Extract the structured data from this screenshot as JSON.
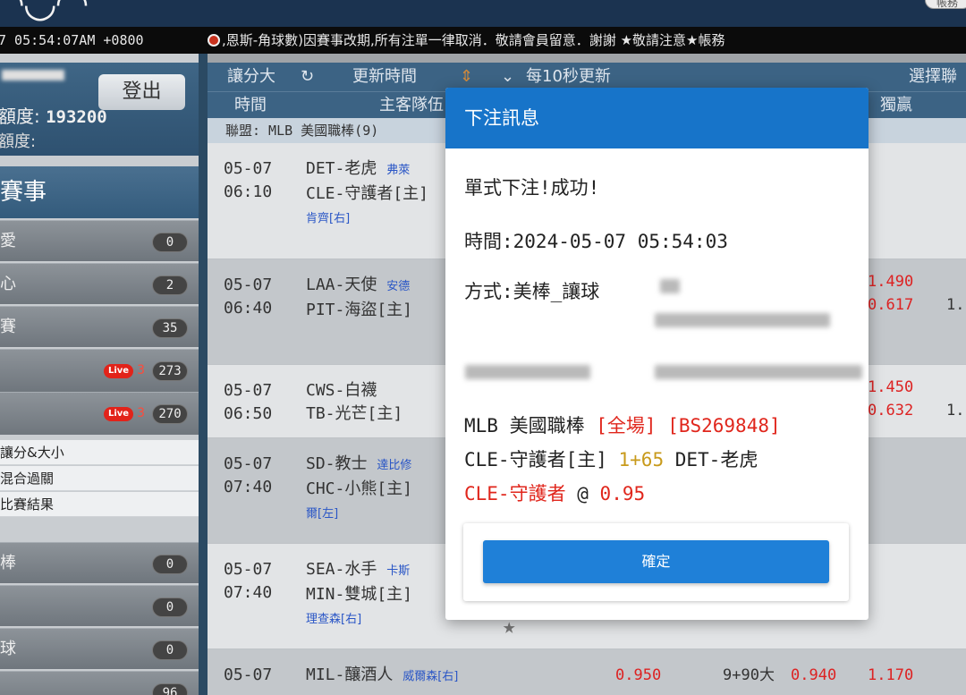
{
  "header": {
    "account_label": "帳務"
  },
  "infobar": {
    "clock": "7 05:54:07AM +0800",
    "marquee": ",恩斯-角球數)因賽事改期,所有注單一律取消．敬請會員留意．謝謝 ★敬請注意★帳務"
  },
  "sidebar": {
    "logout_label": "登出",
    "credit_label": "額度:",
    "credit_value": "193200",
    "credit_label2": "額度:",
    "events_title": "賽事",
    "items": [
      {
        "label": "愛",
        "count": "0"
      },
      {
        "label": "心",
        "count": "2"
      },
      {
        "label": "賽",
        "count": "35"
      },
      {
        "label": "",
        "live": "3",
        "count": "273"
      },
      {
        "label": "",
        "live": "3",
        "count": "270"
      }
    ],
    "live_tag": "Live",
    "sub_items": [
      "讓分&大小",
      "混合過關",
      "比賽結果"
    ],
    "items2": [
      {
        "label": "棒",
        "count": "0"
      },
      {
        "label": "",
        "count": "0"
      },
      {
        "label": "球",
        "count": "0"
      },
      {
        "label": "",
        "count": "96"
      }
    ]
  },
  "toolbar": {
    "tab": "讓分大",
    "refresh_label": "更新時間",
    "interval_label": "每10秒更新",
    "select_label": "選擇聯"
  },
  "columns": {
    "time": "時間",
    "teams": "主客隊伍",
    "win": "獨贏"
  },
  "league": "聯盟: MLB 美國職棒(9)",
  "games": [
    {
      "date": "05-07",
      "time": "06:10",
      "away": "DET-老虎",
      "away_pitcher": "弗萊",
      "home": "CLE-守護者[主]",
      "home_pitcher": "肯齊[右]"
    },
    {
      "date": "05-07",
      "time": "06:40",
      "away": "LAA-天使",
      "away_pitcher": "安德",
      "home": "PIT-海盜[主]",
      "odds": [
        "1.490",
        "0.617"
      ],
      "extra": "1."
    },
    {
      "date": "05-07",
      "time": "06:50",
      "away": "CWS-白襪",
      "home": "TB-光芒[主]",
      "odds": [
        "1.450",
        "0.632"
      ],
      "extra": "1."
    },
    {
      "date": "05-07",
      "time": "07:40",
      "away": "SD-教士",
      "away_pitcher": "達比修",
      "home": "CHC-小熊[主]",
      "home_pitcher": "爾[左]"
    },
    {
      "date": "05-07",
      "time": "07:40",
      "away": "SEA-水手",
      "away_pitcher": "卡斯",
      "home": "MIN-雙城[主]",
      "home_pitcher": "理查森[右]"
    },
    {
      "date": "05-07",
      "away": "MIL-釀酒人",
      "away_pitcher": "威爾森[右]",
      "odd1": "0.950",
      "line": "9+90大",
      "odd2": "0.940",
      "odd3": "1.170"
    }
  ],
  "modal": {
    "title": "下注訊息",
    "status": "單式下注!成功!",
    "time_line": "時間:2024-05-07 05:54:03",
    "method_line": "方式:美棒_讓球",
    "league": "MLB 美國職棒",
    "period": "[全場]",
    "ticket": "[BS269848]",
    "home": "CLE-守護者[主]",
    "handicap": "1+65",
    "away": "DET-老虎",
    "pick": "CLE-守護者",
    "at": "@",
    "odds": "0.95",
    "confirm_label": "確定"
  }
}
